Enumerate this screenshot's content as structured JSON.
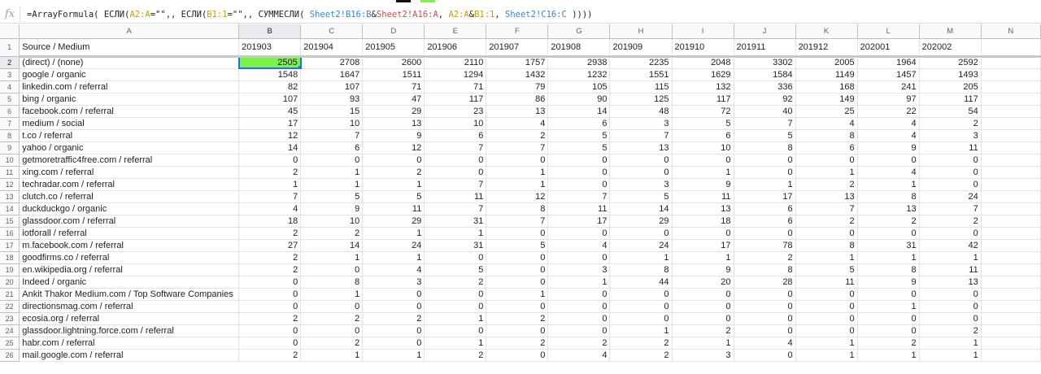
{
  "formula_bar": {
    "icon": "fx",
    "parts": [
      {
        "t": "=ArrayFormula( ЕСЛИ(",
        "c": ""
      },
      {
        "t": "A2:A",
        "c": "r1"
      },
      {
        "t": "=\"\",, ЕСЛИ(",
        "c": ""
      },
      {
        "t": "B1:1",
        "c": "r1"
      },
      {
        "t": "=\"\",, СУММЕСЛИ( ",
        "c": ""
      },
      {
        "t": "Sheet2!B16:B",
        "c": "r2"
      },
      {
        "t": "&",
        "c": ""
      },
      {
        "t": "Sheet2!A16:A",
        "c": "r3"
      },
      {
        "t": ", ",
        "c": ""
      },
      {
        "t": "A2:A",
        "c": "r1"
      },
      {
        "t": "&",
        "c": ""
      },
      {
        "t": "B1:1",
        "c": "r1"
      },
      {
        "t": ", ",
        "c": ""
      },
      {
        "t": "Sheet2!C16:C",
        "c": "r2"
      },
      {
        "t": " ))))",
        "c": ""
      }
    ]
  },
  "colors": {
    "selected_cell": "#7cf24b",
    "selection_border": "#1a73e8"
  },
  "column_letters": [
    "A",
    "B",
    "C",
    "D",
    "E",
    "F",
    "G",
    "H",
    "I",
    "J",
    "K",
    "L",
    "M",
    "N"
  ],
  "header_row": [
    "Source / Medium",
    "201903",
    "201904",
    "201905",
    "201906",
    "201907",
    "201908",
    "201909",
    "201910",
    "201911",
    "201912",
    "202001",
    "202002",
    ""
  ],
  "rows": [
    {
      "label": "(direct) / (none)",
      "values": [
        2505,
        2708,
        2600,
        2110,
        1757,
        2938,
        2235,
        2048,
        3302,
        2005,
        1964,
        2592
      ]
    },
    {
      "label": "google / organic",
      "values": [
        1548,
        1647,
        1511,
        1294,
        1432,
        1232,
        1551,
        1629,
        1584,
        1149,
        1457,
        1493
      ]
    },
    {
      "label": "linkedin.com / referral",
      "values": [
        82,
        107,
        71,
        71,
        79,
        105,
        115,
        132,
        336,
        168,
        241,
        205
      ]
    },
    {
      "label": "bing / organic",
      "values": [
        107,
        93,
        47,
        117,
        86,
        90,
        125,
        117,
        92,
        149,
        97,
        117
      ]
    },
    {
      "label": "facebook.com / referral",
      "values": [
        45,
        15,
        29,
        23,
        13,
        14,
        48,
        72,
        40,
        25,
        22,
        54
      ]
    },
    {
      "label": "medium / social",
      "values": [
        17,
        10,
        13,
        10,
        4,
        6,
        3,
        5,
        7,
        4,
        4,
        2
      ]
    },
    {
      "label": "t.co / referral",
      "values": [
        12,
        7,
        9,
        6,
        2,
        5,
        7,
        6,
        5,
        8,
        4,
        3
      ]
    },
    {
      "label": "yahoo / organic",
      "values": [
        14,
        6,
        12,
        7,
        7,
        5,
        13,
        10,
        8,
        6,
        9,
        11
      ]
    },
    {
      "label": "getmoretraffic4free.com / referral",
      "values": [
        0,
        0,
        0,
        0,
        0,
        0,
        0,
        0,
        0,
        0,
        0,
        0
      ]
    },
    {
      "label": "xing.com / referral",
      "values": [
        2,
        1,
        2,
        0,
        1,
        0,
        0,
        1,
        0,
        1,
        4,
        0
      ]
    },
    {
      "label": "techradar.com / referral",
      "values": [
        1,
        1,
        1,
        7,
        1,
        0,
        3,
        9,
        1,
        2,
        1,
        0
      ]
    },
    {
      "label": "clutch.co / referral",
      "values": [
        7,
        5,
        5,
        11,
        12,
        7,
        5,
        11,
        17,
        13,
        8,
        24
      ]
    },
    {
      "label": "duckduckgo / organic",
      "values": [
        4,
        9,
        11,
        7,
        8,
        11,
        14,
        13,
        6,
        7,
        13,
        7
      ]
    },
    {
      "label": "glassdoor.com / referral",
      "values": [
        18,
        10,
        29,
        31,
        7,
        17,
        29,
        18,
        6,
        2,
        2,
        2
      ]
    },
    {
      "label": "iotforall / referral",
      "values": [
        2,
        2,
        1,
        1,
        0,
        0,
        0,
        0,
        0,
        0,
        0,
        0
      ]
    },
    {
      "label": "m.facebook.com / referral",
      "values": [
        27,
        14,
        24,
        31,
        5,
        4,
        24,
        17,
        78,
        8,
        31,
        42
      ]
    },
    {
      "label": "goodfirms.co / referral",
      "values": [
        2,
        1,
        1,
        0,
        0,
        0,
        1,
        1,
        2,
        1,
        1,
        1
      ]
    },
    {
      "label": "en.wikipedia.org / referral",
      "values": [
        2,
        0,
        4,
        5,
        0,
        3,
        8,
        9,
        8,
        5,
        8,
        11
      ]
    },
    {
      "label": "Indeed / organic",
      "values": [
        0,
        8,
        3,
        2,
        0,
        1,
        44,
        20,
        28,
        11,
        9,
        13
      ]
    },
    {
      "label": "Ankit Thakor Medium.com / Top Software Companies",
      "values": [
        0,
        1,
        0,
        0,
        1,
        0,
        0,
        0,
        0,
        0,
        0,
        0
      ]
    },
    {
      "label": "directionsmag.com / referral",
      "values": [
        0,
        0,
        0,
        0,
        0,
        0,
        0,
        0,
        0,
        0,
        1,
        0
      ]
    },
    {
      "label": "ecosia.org / referral",
      "values": [
        2,
        2,
        2,
        1,
        2,
        0,
        0,
        0,
        0,
        0,
        0,
        0
      ]
    },
    {
      "label": "glassdoor.lightning.force.com / referral",
      "values": [
        0,
        0,
        0,
        0,
        0,
        0,
        1,
        2,
        0,
        0,
        0,
        2
      ]
    },
    {
      "label": "habr.com / referral",
      "values": [
        0,
        2,
        0,
        1,
        2,
        2,
        2,
        1,
        4,
        1,
        2,
        1
      ]
    },
    {
      "label": "mail.google.com / referral",
      "values": [
        2,
        1,
        1,
        2,
        0,
        4,
        2,
        3,
        0,
        1,
        1,
        1
      ]
    }
  ]
}
